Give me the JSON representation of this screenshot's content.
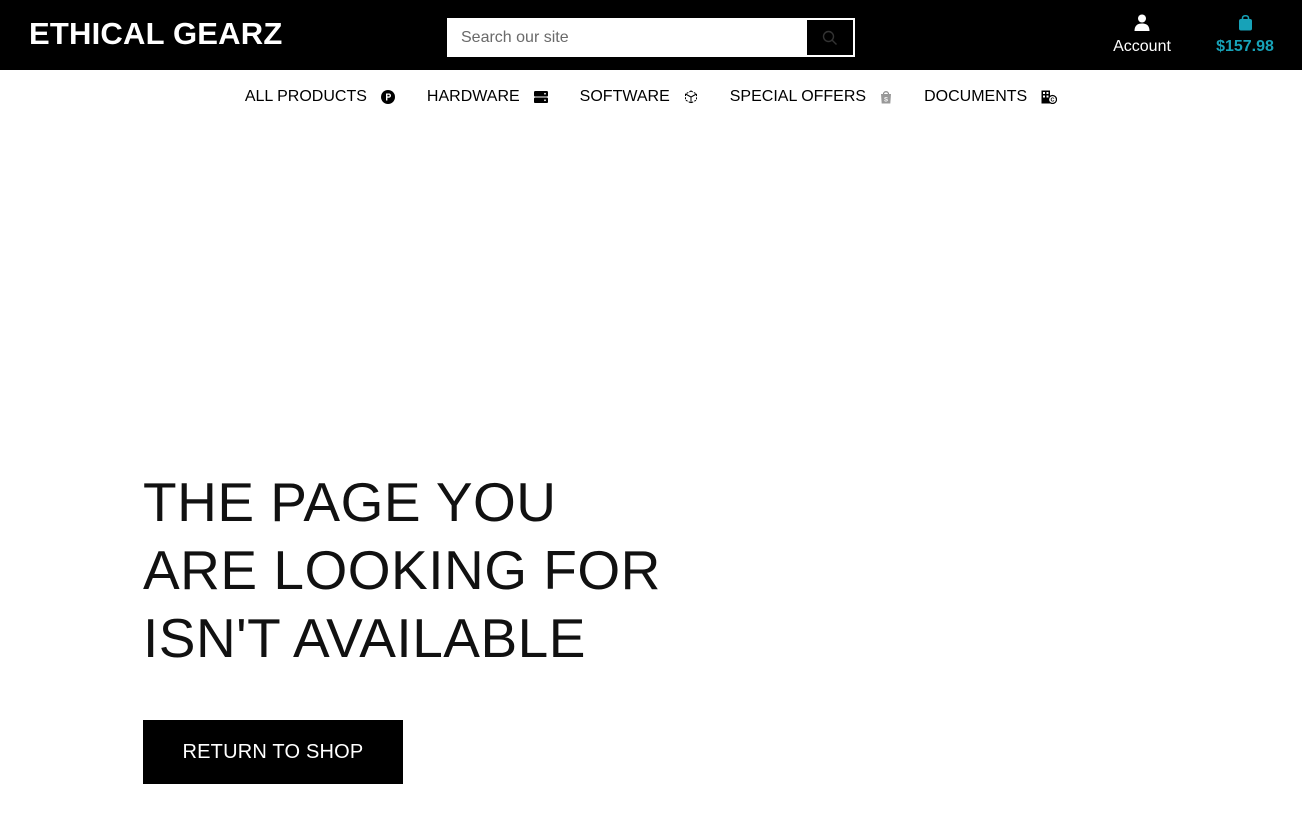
{
  "brand": {
    "name": "ETHICAL GEARZ"
  },
  "search": {
    "placeholder": "Search our site",
    "value": ""
  },
  "account": {
    "label": "Account"
  },
  "cart": {
    "total": "$157.98",
    "accent_color": "#17a2b8"
  },
  "nav": {
    "items": [
      {
        "label": "ALL PRODUCTS",
        "icon": "product-hunt-icon"
      },
      {
        "label": "HARDWARE",
        "icon": "server-icon"
      },
      {
        "label": "SOFTWARE",
        "icon": "cube-icon"
      },
      {
        "label": "SPECIAL OFFERS",
        "icon": "shopify-bag-icon"
      },
      {
        "label": "DOCUMENTS",
        "icon": "building-copyright-icon"
      }
    ]
  },
  "error": {
    "lines": [
      "THE PAGE YOU",
      "ARE LOOKING FOR",
      "ISN'T AVAILABLE"
    ],
    "button_label": "RETURN TO SHOP"
  }
}
